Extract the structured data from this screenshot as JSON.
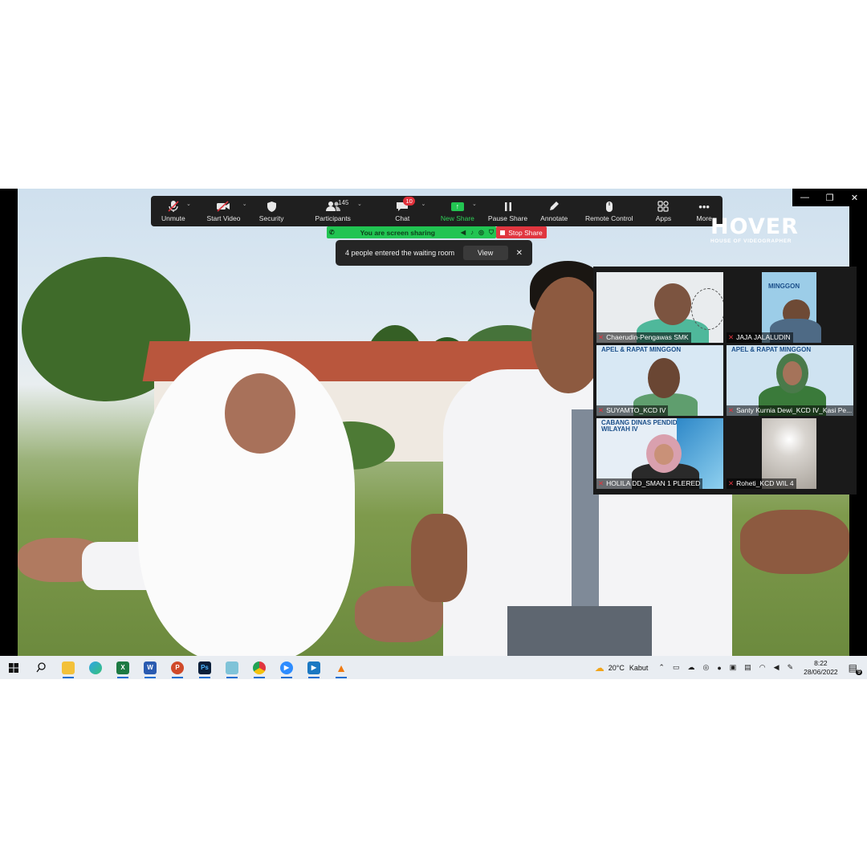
{
  "toolbar": {
    "items": [
      {
        "label": "Unmute",
        "icon": "microphone-muted-icon"
      },
      {
        "label": "Start Video",
        "icon": "camera-off-icon"
      },
      {
        "label": "Security",
        "icon": "shield-icon"
      },
      {
        "label": "Participants",
        "icon": "participants-icon",
        "count": "145"
      },
      {
        "label": "Chat",
        "icon": "chat-icon",
        "badge": "10"
      },
      {
        "label": "New Share",
        "icon": "share-arrow-icon"
      },
      {
        "label": "Pause Share",
        "icon": "pause-icon"
      },
      {
        "label": "Annotate",
        "icon": "pen-icon"
      },
      {
        "label": "Remote Control",
        "icon": "mouse-icon"
      },
      {
        "label": "Apps",
        "icon": "apps-icon"
      },
      {
        "label": "More",
        "icon": "more-dots-icon"
      }
    ]
  },
  "share_bar": {
    "text": "You are screen sharing",
    "stop_label": "Stop Share"
  },
  "waiting_room": {
    "message": "4 people entered the waiting room",
    "view_label": "View"
  },
  "logo": {
    "title": "HOVER",
    "subtitle": "HOUSE OF VIDEOGRAPHER"
  },
  "gallery": {
    "tiles": [
      {
        "name": "Chaerudin-Pengawas SMK"
      },
      {
        "name": "JAJA JALALUDIN",
        "banner": "MINGGON"
      },
      {
        "name": "SUYAMTO_KCD IV",
        "banner": "APEL & RAPAT MINGGON"
      },
      {
        "name": "Santy Kurnia Dewi_KCD IV_Kasi Pe...",
        "banner": "APEL & RAPAT MINGGON"
      },
      {
        "name": "HOLILA DD_SMAN 1 PLERED",
        "banner": "CABANG DINAS PENDIDIKAN WILAYAH IV"
      },
      {
        "name": "Roheti_KCD WIL 4"
      }
    ]
  },
  "taskbar": {
    "apps": [
      "start-icon",
      "search-icon",
      "file-explorer-icon",
      "edge-icon",
      "excel-icon",
      "word-icon",
      "powerpoint-icon",
      "photoshop-icon",
      "notepad-icon",
      "chrome-icon",
      "zoom-icon",
      "media-player-icon",
      "vlc-icon"
    ],
    "weather": "20°C",
    "weather_desc": "Kabut",
    "time": "8:22",
    "date": "28/06/2022",
    "notifications": "9"
  },
  "colors": {
    "accent_green": "#21c452",
    "stop_red": "#e0363f",
    "toolbar_bg": "#1f1f1f"
  }
}
